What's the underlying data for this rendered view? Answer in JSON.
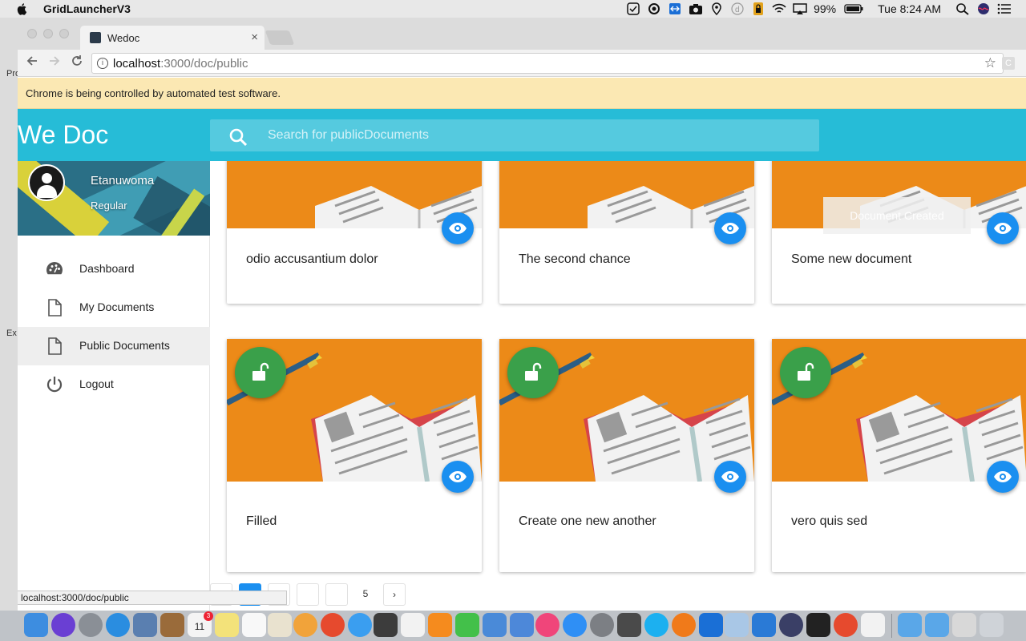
{
  "menubar": {
    "app_name": "GridLauncherV3",
    "battery": "99%",
    "clock": "Tue 8:24 AM"
  },
  "background_window": {
    "fragments": [
      "Pro",
      "Ex"
    ]
  },
  "browser": {
    "tab_title": "Wedoc",
    "tab_close": "×",
    "url_host": "localhost",
    "url_path": ":3000/doc/public",
    "ext_letter": "C",
    "infobar": "Chrome is being controlled by automated test software.",
    "status_url": "localhost:3000/doc/public"
  },
  "app": {
    "brand": "We Doc",
    "search_placeholder": "Search for publicDocuments",
    "user": {
      "name": "Etanuwoma",
      "role": "Regular"
    },
    "nav": [
      {
        "label": "Dashboard",
        "icon": "palette-icon"
      },
      {
        "label": "My Documents",
        "icon": "document-icon"
      },
      {
        "label": "Public Documents",
        "icon": "document-icon",
        "active": true
      },
      {
        "label": "Logout",
        "icon": "power-icon"
      }
    ],
    "toast": "Document Created",
    "cards": [
      {
        "title": "odio accusantium dolor"
      },
      {
        "title": "The second chance"
      },
      {
        "title": "Some new document"
      },
      {
        "title": "Filled"
      },
      {
        "title": "Create one new another"
      },
      {
        "title": "vero quis sed"
      }
    ],
    "pagination": {
      "pages": [
        "",
        "",
        "",
        "",
        "",
        "5"
      ],
      "active_index": 1,
      "next": "›"
    }
  },
  "colors": {
    "appbar": "#26bcd7",
    "cover": "#ec8a18",
    "eye_fab": "#1a8ff0",
    "lock_fab": "#3aa04a"
  },
  "dock": {
    "calendar_day": "11",
    "badge": "3"
  }
}
